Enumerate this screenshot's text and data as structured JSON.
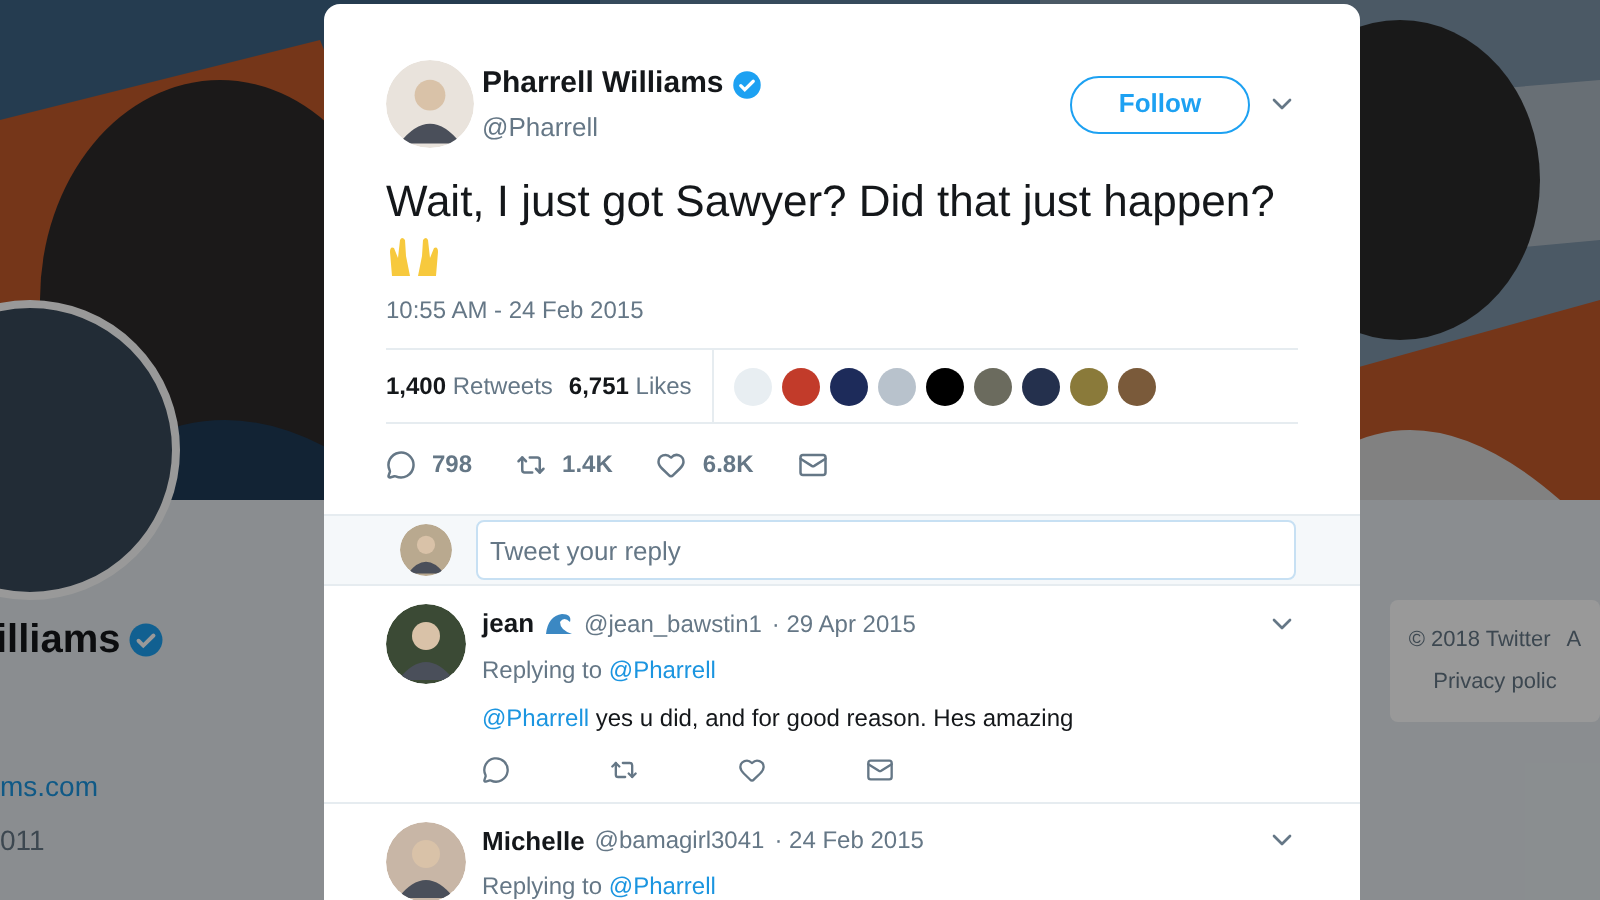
{
  "background": {
    "profile_name": "illiams",
    "verified": true,
    "website": "ms.com",
    "joined": "011",
    "footer": [
      {
        "text": "© 2018 Twitter"
      },
      {
        "text": "A"
      },
      {
        "text": "Privacy polic"
      }
    ]
  },
  "tweet": {
    "author": "Pharrell Williams",
    "verified": true,
    "handle": "@Pharrell",
    "follow_button": "Follow",
    "text": "Wait, I just got Sawyer? Did that just happen?",
    "time": "10:55 AM - 24 Feb 2015",
    "retweets": {
      "count": "1,400",
      "label": "Retweets"
    },
    "likes": {
      "count": "6,751",
      "label": "Likes"
    },
    "actions": [
      {
        "kind": "reply",
        "count": "798"
      },
      {
        "kind": "retweet",
        "count": "1.4K"
      },
      {
        "kind": "like",
        "count": "6.8K"
      },
      {
        "kind": "message"
      }
    ]
  },
  "reply_box": {
    "placeholder": "Tweet your reply"
  },
  "replies": [
    {
      "name": "jean",
      "wave_badge": true,
      "handle": "@jean_bawstin1",
      "date": "· 29 Apr 2015",
      "replying_label": "Replying to",
      "replying_to": "@Pharrell",
      "mention": "@Pharrell",
      "text": "yes u did, and for good reason.  Hes amazing"
    },
    {
      "name": "Michelle",
      "wave_badge": false,
      "handle": "@bamagirl3041",
      "date": "· 24 Feb 2015",
      "replying_label": "Replying to",
      "replying_to": "@Pharrell"
    }
  ]
}
